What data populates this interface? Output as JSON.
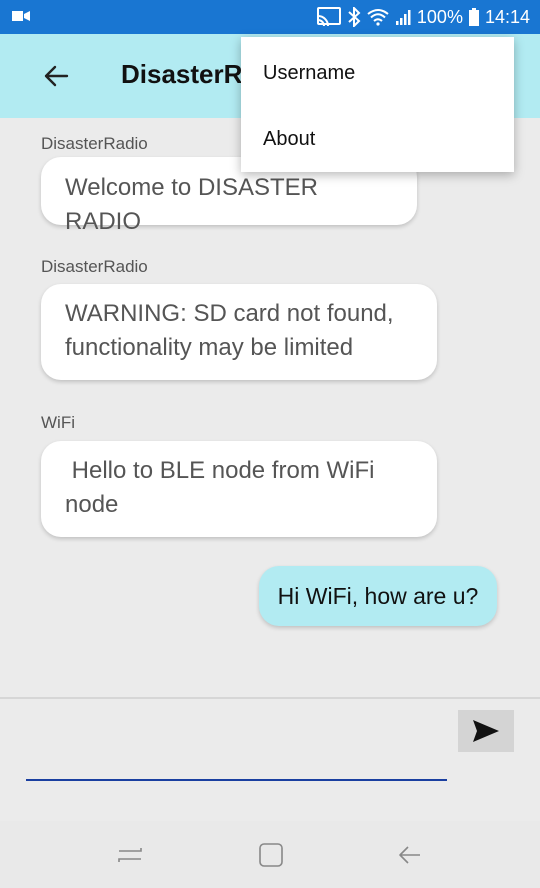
{
  "status_bar": {
    "battery_percent": "100%",
    "time": "14:14",
    "icons": [
      "video-icon",
      "cast-icon",
      "bluetooth-icon",
      "wifi-icon",
      "signal-icon",
      "battery-icon"
    ]
  },
  "app_bar": {
    "title": "DisasterRadio",
    "back_icon": "arrow-left-icon",
    "background": "#b2ebf2"
  },
  "menu": {
    "items": [
      {
        "label": "Username"
      },
      {
        "label": "About"
      }
    ]
  },
  "messages": [
    {
      "sender": "DisasterRadio",
      "text": "Welcome to DISASTER RADIO",
      "direction": "incoming"
    },
    {
      "sender": "DisasterRadio",
      "text": "WARNING: SD card not found, functionality may be limited",
      "direction": "incoming"
    },
    {
      "sender": "WiFi",
      "text": " Hello to BLE node from WiFi node",
      "direction": "incoming"
    },
    {
      "sender": "",
      "text": "Hi WiFi, how are u?",
      "direction": "outgoing"
    }
  ],
  "composer": {
    "value": "",
    "placeholder": "",
    "send_icon": "send-icon"
  },
  "nav_bar": {
    "icons": [
      "recents-icon",
      "home-icon",
      "back-icon"
    ]
  },
  "colors": {
    "status_bar": "#1976d2",
    "accent_bubble": "#b2ebf2",
    "input_underline": "#1a3fa0"
  }
}
